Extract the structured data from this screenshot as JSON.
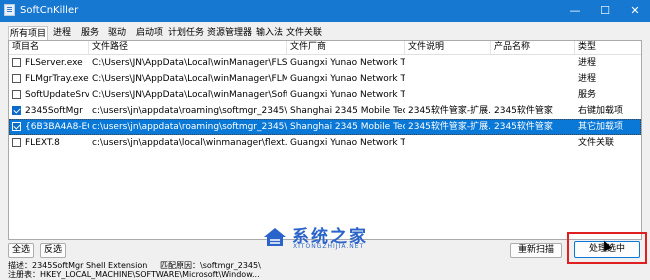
{
  "window": {
    "title": "SoftCnKiller",
    "minimize": "—",
    "maximize": "☐",
    "close": "✕"
  },
  "tabs": [
    "所有项目",
    "进程",
    "服务",
    "驱动",
    "启动项",
    "计划任务",
    "资源管理器",
    "输入法",
    "文件关联"
  ],
  "columns": [
    "项目名",
    "文件路径",
    "文件厂商",
    "文件说明",
    "产品名称",
    "类型"
  ],
  "rows": [
    {
      "checked": false,
      "selected": false,
      "name": "FLServer.exe",
      "path": "C:\\Users\\JN\\AppData\\Local\\winManager\\FLServ...",
      "vendor": "Guangxi Yunao Network Tec...",
      "desc": "",
      "product": "",
      "type": "进程"
    },
    {
      "checked": false,
      "selected": false,
      "name": "FLMgrTray.exe",
      "path": "C:\\Users\\JN\\AppData\\Local\\winManager\\FLMgr...",
      "vendor": "Guangxi Yunao Network Tec...",
      "desc": "",
      "product": "",
      "type": "进程"
    },
    {
      "checked": false,
      "selected": false,
      "name": "SoftUpdateSrv",
      "path": "C:\\Users\\JN\\AppData\\Local\\winManager\\SoftU...",
      "vendor": "Guangxi Yunao Network Tec...",
      "desc": "",
      "product": "",
      "type": "服务"
    },
    {
      "checked": true,
      "selected": false,
      "name": "2345SoftMgr",
      "path": "c:\\users\\jn\\appdata\\roaming\\softmgr_2345\\ap...",
      "vendor": "Shanghai 2345 Mobile Tec...",
      "desc": "2345软件管家-扩展...",
      "product": "2345软件管家",
      "type": "右键加载项"
    },
    {
      "checked": true,
      "selected": true,
      "name": "{6B3BA4A8-EC...",
      "path": "c:\\users\\jn\\appdata\\roaming\\softmgr_2345\\ap...",
      "vendor": "Shanghai 2345 Mobile Tec...",
      "desc": "2345软件管家-扩展...",
      "product": "2345软件管家",
      "type": "其它加载项"
    },
    {
      "checked": false,
      "selected": false,
      "name": "FLEXT.8",
      "path": "c:\\users\\jn\\appdata\\local\\winmanager\\flext.exe",
      "vendor": "Guangxi Yunao Network Tec...",
      "desc": "",
      "product": "",
      "type": "文件关联"
    }
  ],
  "buttons": {
    "select_all": "全选",
    "invert": "反选",
    "rescan": "重新扫描",
    "process": "处理选中"
  },
  "status": {
    "line1_desc": "描述：2345SoftMgr Shell Extension",
    "line1_reason": "匹配原因：\\softmgr_2345\\",
    "line2": "注册表：HKEY_LOCAL_MACHINE\\SOFTWARE\\Microsoft\\Window..."
  },
  "watermark": {
    "text": "系统之家",
    "sub": "XITONGZHIJIA.NET",
    "color": "#2a63c9"
  }
}
